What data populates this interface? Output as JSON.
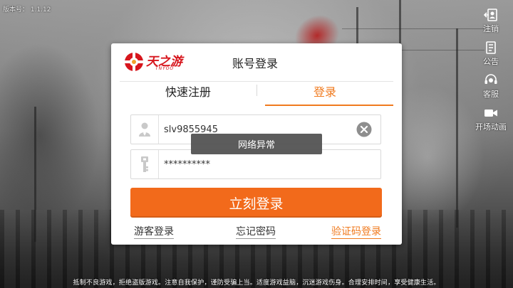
{
  "app": {
    "version_text": "版本号： 1.1.12"
  },
  "side_menu": [
    {
      "label": "注销",
      "icon": "logout-icon"
    },
    {
      "label": "公告",
      "icon": "notice-icon"
    },
    {
      "label": "客服",
      "icon": "customer-service-icon"
    },
    {
      "label": "开场动画",
      "icon": "video-icon"
    }
  ],
  "dialog": {
    "title": "账号登录",
    "logo_text": "天之游",
    "logo_sub": "TNYOO",
    "tabs": [
      {
        "label": "快速注册",
        "active": false
      },
      {
        "label": "登录",
        "active": true
      }
    ],
    "username": {
      "value": "slv9855945",
      "icon": "user-icon"
    },
    "password": {
      "value": "**********",
      "icon": "key-icon"
    },
    "toast": "网络异常",
    "login_button": "立刻登录",
    "links": {
      "guest": "游客登录",
      "forgot": "忘记密码",
      "code": "验证码登录"
    }
  },
  "footer": {
    "notice": "抵制不良游戏，拒绝盗版游戏。注意自我保护，谨防受骗上当。适度游戏益脑，沉迷游戏伤身。合理安排时间，享受健康生活。"
  },
  "colors": {
    "accent": "#f26a1b",
    "tab_active": "#f07a1e",
    "brand_red": "#d7161d",
    "toast_bg": "#505050"
  }
}
